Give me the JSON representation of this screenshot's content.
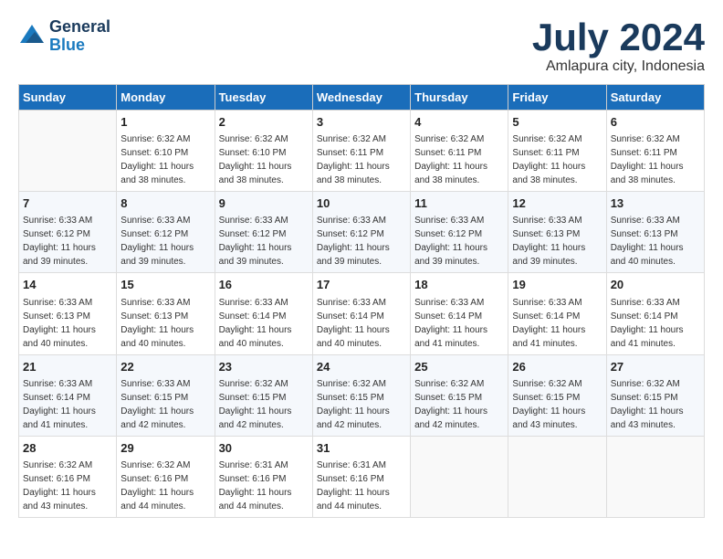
{
  "header": {
    "logo_line1": "General",
    "logo_line2": "Blue",
    "month": "July 2024",
    "location": "Amlapura city, Indonesia"
  },
  "weekdays": [
    "Sunday",
    "Monday",
    "Tuesday",
    "Wednesday",
    "Thursday",
    "Friday",
    "Saturday"
  ],
  "weeks": [
    [
      {
        "day": "",
        "info": ""
      },
      {
        "day": "1",
        "info": "Sunrise: 6:32 AM\nSunset: 6:10 PM\nDaylight: 11 hours\nand 38 minutes."
      },
      {
        "day": "2",
        "info": "Sunrise: 6:32 AM\nSunset: 6:10 PM\nDaylight: 11 hours\nand 38 minutes."
      },
      {
        "day": "3",
        "info": "Sunrise: 6:32 AM\nSunset: 6:11 PM\nDaylight: 11 hours\nand 38 minutes."
      },
      {
        "day": "4",
        "info": "Sunrise: 6:32 AM\nSunset: 6:11 PM\nDaylight: 11 hours\nand 38 minutes."
      },
      {
        "day": "5",
        "info": "Sunrise: 6:32 AM\nSunset: 6:11 PM\nDaylight: 11 hours\nand 38 minutes."
      },
      {
        "day": "6",
        "info": "Sunrise: 6:32 AM\nSunset: 6:11 PM\nDaylight: 11 hours\nand 38 minutes."
      }
    ],
    [
      {
        "day": "7",
        "info": "Sunrise: 6:33 AM\nSunset: 6:12 PM\nDaylight: 11 hours\nand 39 minutes."
      },
      {
        "day": "8",
        "info": "Sunrise: 6:33 AM\nSunset: 6:12 PM\nDaylight: 11 hours\nand 39 minutes."
      },
      {
        "day": "9",
        "info": "Sunrise: 6:33 AM\nSunset: 6:12 PM\nDaylight: 11 hours\nand 39 minutes."
      },
      {
        "day": "10",
        "info": "Sunrise: 6:33 AM\nSunset: 6:12 PM\nDaylight: 11 hours\nand 39 minutes."
      },
      {
        "day": "11",
        "info": "Sunrise: 6:33 AM\nSunset: 6:12 PM\nDaylight: 11 hours\nand 39 minutes."
      },
      {
        "day": "12",
        "info": "Sunrise: 6:33 AM\nSunset: 6:13 PM\nDaylight: 11 hours\nand 39 minutes."
      },
      {
        "day": "13",
        "info": "Sunrise: 6:33 AM\nSunset: 6:13 PM\nDaylight: 11 hours\nand 40 minutes."
      }
    ],
    [
      {
        "day": "14",
        "info": "Sunrise: 6:33 AM\nSunset: 6:13 PM\nDaylight: 11 hours\nand 40 minutes."
      },
      {
        "day": "15",
        "info": "Sunrise: 6:33 AM\nSunset: 6:13 PM\nDaylight: 11 hours\nand 40 minutes."
      },
      {
        "day": "16",
        "info": "Sunrise: 6:33 AM\nSunset: 6:14 PM\nDaylight: 11 hours\nand 40 minutes."
      },
      {
        "day": "17",
        "info": "Sunrise: 6:33 AM\nSunset: 6:14 PM\nDaylight: 11 hours\nand 40 minutes."
      },
      {
        "day": "18",
        "info": "Sunrise: 6:33 AM\nSunset: 6:14 PM\nDaylight: 11 hours\nand 41 minutes."
      },
      {
        "day": "19",
        "info": "Sunrise: 6:33 AM\nSunset: 6:14 PM\nDaylight: 11 hours\nand 41 minutes."
      },
      {
        "day": "20",
        "info": "Sunrise: 6:33 AM\nSunset: 6:14 PM\nDaylight: 11 hours\nand 41 minutes."
      }
    ],
    [
      {
        "day": "21",
        "info": "Sunrise: 6:33 AM\nSunset: 6:14 PM\nDaylight: 11 hours\nand 41 minutes."
      },
      {
        "day": "22",
        "info": "Sunrise: 6:33 AM\nSunset: 6:15 PM\nDaylight: 11 hours\nand 42 minutes."
      },
      {
        "day": "23",
        "info": "Sunrise: 6:32 AM\nSunset: 6:15 PM\nDaylight: 11 hours\nand 42 minutes."
      },
      {
        "day": "24",
        "info": "Sunrise: 6:32 AM\nSunset: 6:15 PM\nDaylight: 11 hours\nand 42 minutes."
      },
      {
        "day": "25",
        "info": "Sunrise: 6:32 AM\nSunset: 6:15 PM\nDaylight: 11 hours\nand 42 minutes."
      },
      {
        "day": "26",
        "info": "Sunrise: 6:32 AM\nSunset: 6:15 PM\nDaylight: 11 hours\nand 43 minutes."
      },
      {
        "day": "27",
        "info": "Sunrise: 6:32 AM\nSunset: 6:15 PM\nDaylight: 11 hours\nand 43 minutes."
      }
    ],
    [
      {
        "day": "28",
        "info": "Sunrise: 6:32 AM\nSunset: 6:16 PM\nDaylight: 11 hours\nand 43 minutes."
      },
      {
        "day": "29",
        "info": "Sunrise: 6:32 AM\nSunset: 6:16 PM\nDaylight: 11 hours\nand 44 minutes."
      },
      {
        "day": "30",
        "info": "Sunrise: 6:31 AM\nSunset: 6:16 PM\nDaylight: 11 hours\nand 44 minutes."
      },
      {
        "day": "31",
        "info": "Sunrise: 6:31 AM\nSunset: 6:16 PM\nDaylight: 11 hours\nand 44 minutes."
      },
      {
        "day": "",
        "info": ""
      },
      {
        "day": "",
        "info": ""
      },
      {
        "day": "",
        "info": ""
      }
    ]
  ]
}
